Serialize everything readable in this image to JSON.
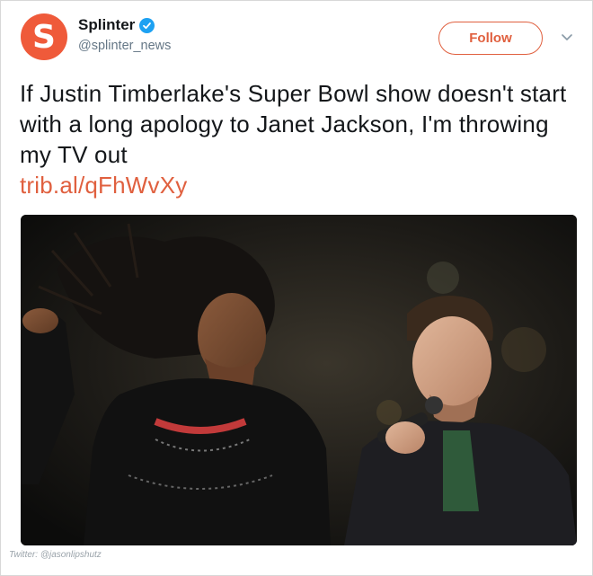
{
  "account": {
    "display_name": "Splinter",
    "handle": "@splinter_news",
    "avatar_letter": "S",
    "verified": true,
    "brand_color": "#ef5a3a"
  },
  "actions": {
    "follow_label": "Follow",
    "more_icon": "chevron-down-icon"
  },
  "tweet": {
    "text": "If Justin Timberlake's Super Bowl show doesn't start with a long apology to Janet Jackson, I'm throwing my TV out",
    "link": "trib.al/qFhWvXy",
    "link_color": "#e0603f"
  },
  "media": {
    "type": "photo"
  },
  "credit": "Twitter: @jasonlipshutz"
}
